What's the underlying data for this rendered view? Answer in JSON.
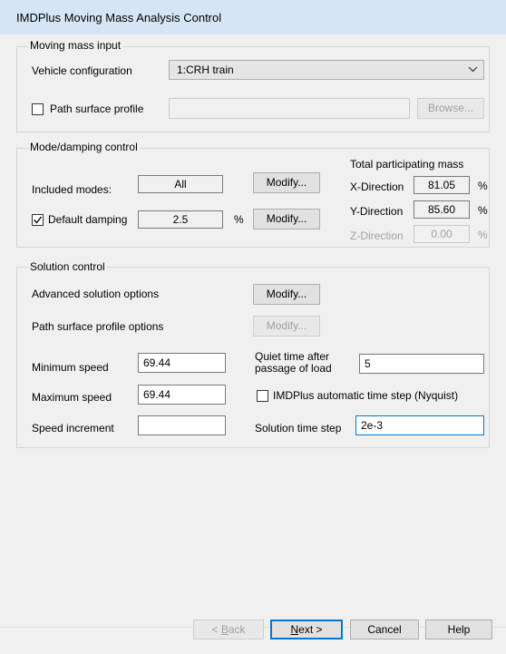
{
  "window": {
    "title": "IMDPlus Moving Mass Analysis Control"
  },
  "moving_mass": {
    "legend": "Moving mass input",
    "vehicle_label": "Vehicle configuration",
    "vehicle_value": "1:CRH train",
    "path_checkbox_label": "Path surface profile",
    "path_checkbox_checked": false,
    "path_value": "",
    "browse_label": "Browse..."
  },
  "mode": {
    "legend": "Mode/damping control",
    "included_label": "Included modes:",
    "included_value": "All",
    "modify_label": "Modify...",
    "damping_label": "Default damping",
    "damping_checked": true,
    "damping_value": "2.5",
    "damping_unit": "%",
    "mass_title": "Total participating mass",
    "directions": [
      {
        "label": "X-Direction",
        "value": "81.05",
        "unit": "%"
      },
      {
        "label": "Y-Direction",
        "value": "85.60",
        "unit": "%"
      },
      {
        "label": "Z-Direction",
        "value": "0.00",
        "unit": "%"
      }
    ]
  },
  "solution": {
    "legend": "Solution control",
    "advanced_label": "Advanced solution options",
    "path_options_label": "Path surface profile options",
    "modify_label": "Modify...",
    "min_speed_label": "Minimum speed",
    "min_speed_value": "69.44",
    "max_speed_label": "Maximum speed",
    "max_speed_value": "69.44",
    "increment_label": "Speed increment",
    "increment_value": "",
    "quiet_label_line1": "Quiet time after",
    "quiet_label_line2": "passage of load",
    "quiet_value": "5",
    "nyquist_label": "IMDPlus automatic time step (Nyquist)",
    "nyquist_checked": false,
    "timestep_label": "Solution time step",
    "timestep_value": "2e-3"
  },
  "footer": {
    "back_prefix": "< ",
    "back_key": "B",
    "back_rest": "ack",
    "next_key": "N",
    "next_rest": "ext >",
    "cancel_label": "Cancel",
    "help_label": "Help"
  }
}
